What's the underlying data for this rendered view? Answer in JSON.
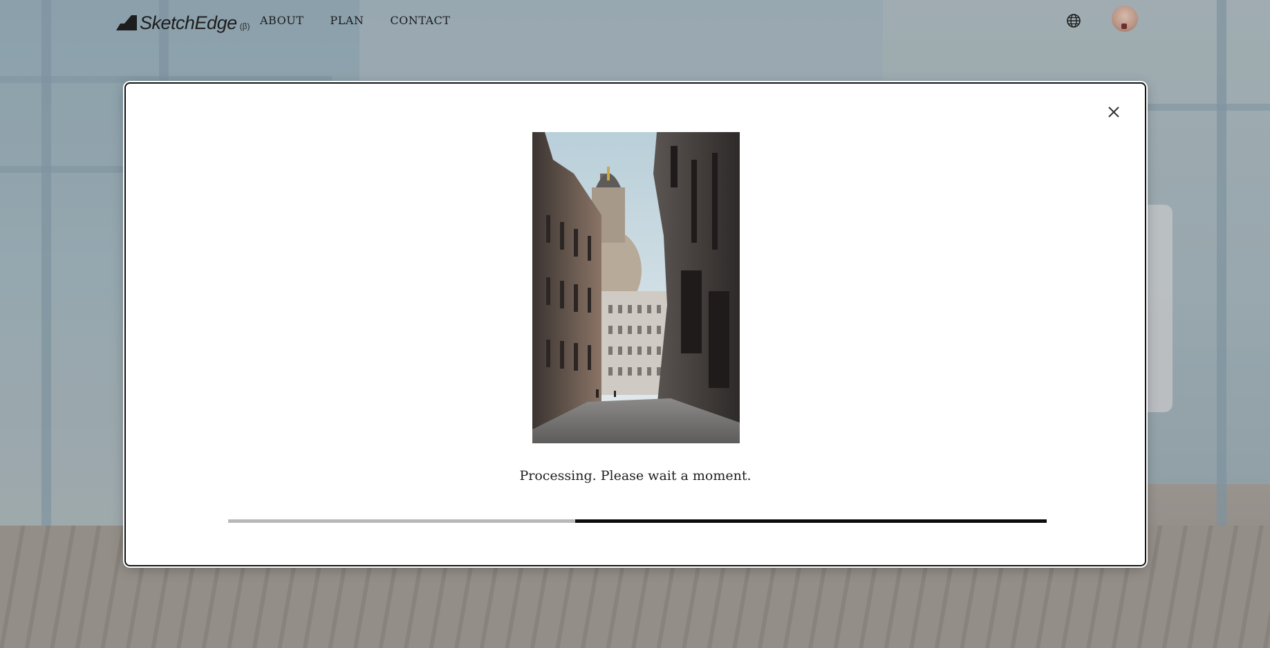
{
  "brand": {
    "name": "SketchEdge",
    "beta": "(β)"
  },
  "nav": {
    "items": [
      {
        "label": "ABOUT"
      },
      {
        "label": "PLAN"
      },
      {
        "label": "CONTACT"
      }
    ]
  },
  "header_icons": {
    "language": "globe-icon",
    "account": "avatar"
  },
  "modal": {
    "status": "Processing. Please wait a moment.",
    "progress": {
      "start_fraction": 0.424,
      "end_fraction": 1.0
    },
    "close_icon": "close-icon",
    "image": "street-photo"
  },
  "colors": {
    "text": "#1e1e1e",
    "progress_track": "#b8b8b8",
    "progress_fill": "#0c0c0c",
    "modal_bg": "#ffffff"
  }
}
